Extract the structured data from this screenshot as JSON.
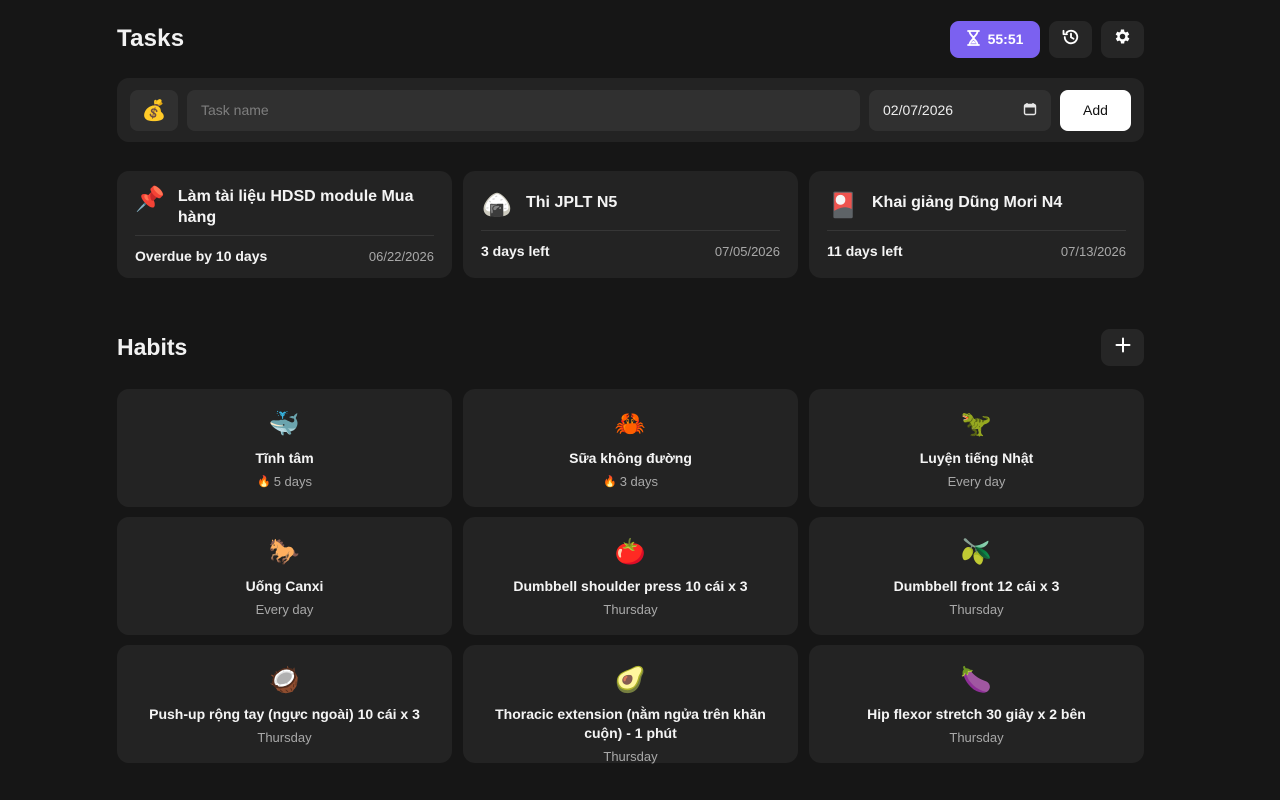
{
  "header": {
    "title": "Tasks",
    "timer": "55:51",
    "hourglass_icon": "⏳"
  },
  "add_task": {
    "emoji": "💰",
    "placeholder": "Task name",
    "date": "02/07/2026",
    "add_label": "Add"
  },
  "tasks": [
    {
      "emoji": "📌",
      "title": "Làm tài liệu HDSD module Mua hàng",
      "status": "Overdue by 10 days",
      "date": "06/22/2026"
    },
    {
      "emoji": "🍙",
      "title": "Thi JPLT N5",
      "status": "3 days left",
      "date": "07/05/2026"
    },
    {
      "emoji": "🎴",
      "title": "Khai giảng Dũng Mori N4",
      "status": "11 days left",
      "date": "07/13/2026"
    }
  ],
  "habits_section": {
    "title": "Habits"
  },
  "habits": [
    {
      "emoji": "🐳",
      "name": "Tĩnh tâm",
      "sub": "5 days",
      "streak": true
    },
    {
      "emoji": "🦀",
      "name": "Sữa không đường",
      "sub": "3 days",
      "streak": true
    },
    {
      "emoji": "🦖",
      "name": "Luyện tiếng Nhật",
      "sub": "Every day",
      "streak": false
    },
    {
      "emoji": "🐎",
      "name": "Uống Canxi",
      "sub": "Every day",
      "streak": false
    },
    {
      "emoji": "🍅",
      "name": "Dumbbell shoulder press 10 cái x 3",
      "sub": "Thursday",
      "streak": false
    },
    {
      "emoji": "🫒",
      "name": "Dumbbell front 12 cái x 3",
      "sub": "Thursday",
      "streak": false
    },
    {
      "emoji": "🥥",
      "name": "Push-up rộng tay (ngực ngoài) 10 cái x 3",
      "sub": "Thursday",
      "streak": false
    },
    {
      "emoji": "🥑",
      "name": "Thoracic extension (nằm ngửa trên khăn cuộn) - 1 phút",
      "sub": "Thursday",
      "streak": false
    },
    {
      "emoji": "🍆",
      "name": "Hip flexor stretch 30 giây x 2 bên",
      "sub": "Thursday",
      "streak": false
    }
  ],
  "streak_icon": "🔥",
  "colors": {
    "accent": "#7b61f0",
    "background": "#161616",
    "card": "#232323"
  }
}
